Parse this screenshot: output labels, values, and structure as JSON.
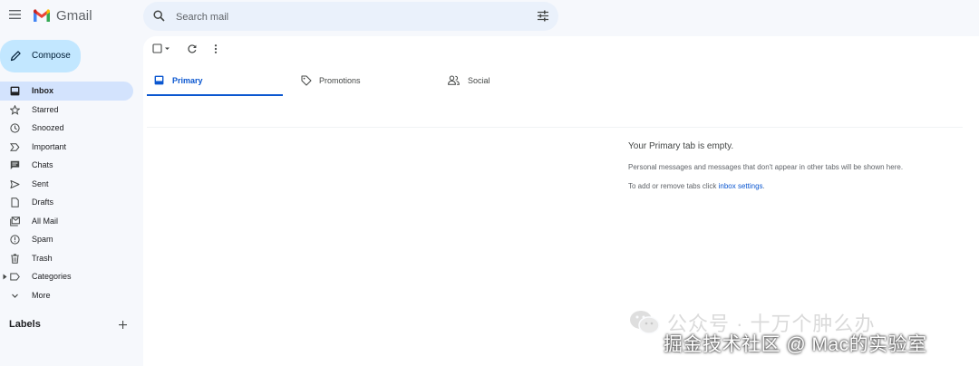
{
  "app": {
    "name": "Gmail"
  },
  "search": {
    "placeholder": "Search mail"
  },
  "sidebar": {
    "compose_label": "Compose",
    "items": [
      {
        "label": "Inbox",
        "icon": "inbox-icon",
        "active": true
      },
      {
        "label": "Starred",
        "icon": "star-icon"
      },
      {
        "label": "Snoozed",
        "icon": "clock-icon"
      },
      {
        "label": "Important",
        "icon": "important-icon"
      },
      {
        "label": "Chats",
        "icon": "chat-icon"
      },
      {
        "label": "Sent",
        "icon": "send-icon"
      },
      {
        "label": "Drafts",
        "icon": "draft-icon"
      },
      {
        "label": "All Mail",
        "icon": "all-mail-icon"
      },
      {
        "label": "Spam",
        "icon": "spam-icon"
      },
      {
        "label": "Trash",
        "icon": "trash-icon"
      },
      {
        "label": "Categories",
        "icon": "label-icon"
      },
      {
        "label": "More",
        "icon": "chevron-down-icon"
      }
    ],
    "labels_heading": "Labels"
  },
  "tabs": [
    {
      "label": "Primary",
      "icon": "inbox-icon",
      "active": true
    },
    {
      "label": "Promotions",
      "icon": "tag-icon"
    },
    {
      "label": "Social",
      "icon": "people-icon"
    }
  ],
  "empty_state": {
    "title": "Your Primary tab is empty.",
    "line1": "Personal messages and messages that don't appear in other tabs will be shown here.",
    "line2_prefix": "To add or remove tabs click",
    "line2_link": "inbox settings",
    "line2_suffix": "."
  },
  "watermark": {
    "line1": "公众号 · 十万个肿么办",
    "line2": "掘金技术社区 @ Mac的实验室"
  },
  "colors": {
    "accent": "#0b57d0",
    "compose_bg": "#c2e7ff",
    "active_nav_bg": "#d3e3fd",
    "page_bg": "#f6f8fc"
  }
}
